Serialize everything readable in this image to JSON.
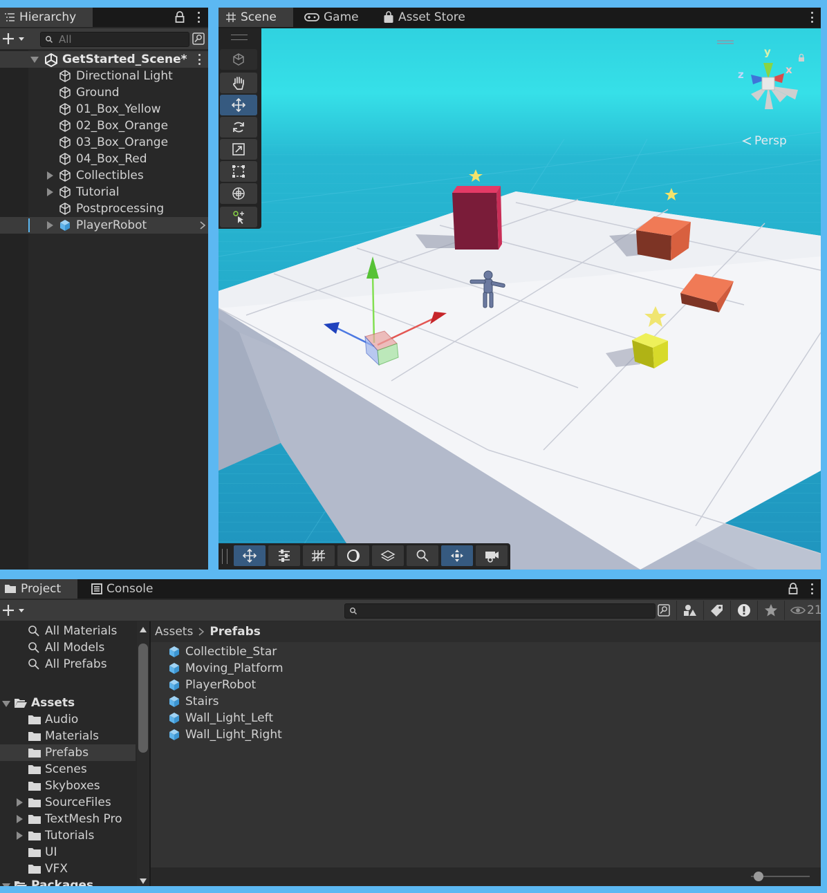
{
  "hierarchy": {
    "tab_label": "Hierarchy",
    "search_placeholder": "All",
    "scene_name": "GetStarted_Scene*",
    "items": [
      {
        "label": "Directional Light",
        "expandable": false
      },
      {
        "label": "Ground",
        "expandable": false
      },
      {
        "label": "01_Box_Yellow",
        "expandable": false
      },
      {
        "label": "02_Box_Orange",
        "expandable": false
      },
      {
        "label": "03_Box_Orange",
        "expandable": false
      },
      {
        "label": "04_Box_Red",
        "expandable": false
      },
      {
        "label": "Collectibles",
        "expandable": true
      },
      {
        "label": "Tutorial",
        "expandable": true
      },
      {
        "label": "Postprocessing",
        "expandable": false
      },
      {
        "label": "PlayerRobot",
        "expandable": true,
        "selected": true,
        "prefab": true
      }
    ]
  },
  "scene_view": {
    "tabs": [
      {
        "label": "Scene",
        "icon": "grid-icon",
        "active": true
      },
      {
        "label": "Game",
        "icon": "gamepad-icon",
        "active": false
      },
      {
        "label": "Asset Store",
        "icon": "bag-icon",
        "active": false
      }
    ],
    "projection_label": "Persp",
    "gizmo_axes": {
      "x": "x",
      "y": "y",
      "z": "z"
    },
    "tools": [
      "view-cube-icon",
      "hand-icon",
      "move-icon",
      "rotate-icon",
      "scale-icon",
      "rect-icon",
      "transform-icon",
      "custom-tool-icon"
    ],
    "selected_tool": "move-icon",
    "overlay_buttons": [
      "move-icon",
      "sliders-icon",
      "grid-snap-icon",
      "shading-icon",
      "layers-icon",
      "search-icon",
      "gizmo-icon",
      "camera-icon"
    ],
    "overlay_selected": [
      "move-icon",
      "gizmo-icon"
    ]
  },
  "project": {
    "tabs": [
      {
        "label": "Project",
        "icon": "folder-icon",
        "active": true
      },
      {
        "label": "Console",
        "icon": "console-icon",
        "active": false
      }
    ],
    "hidden_count": "21",
    "favorites": [
      "All Materials",
      "All Models",
      "All Prefabs"
    ],
    "assets_root": "Assets",
    "folders": [
      {
        "label": "Audio",
        "expandable": false
      },
      {
        "label": "Materials",
        "expandable": false
      },
      {
        "label": "Prefabs",
        "expandable": false,
        "selected": true
      },
      {
        "label": "Scenes",
        "expandable": false
      },
      {
        "label": "Skyboxes",
        "expandable": false
      },
      {
        "label": "SourceFiles",
        "expandable": true
      },
      {
        "label": "TextMesh Pro",
        "expandable": true
      },
      {
        "label": "Tutorials",
        "expandable": true
      },
      {
        "label": "UI",
        "expandable": false
      },
      {
        "label": "VFX",
        "expandable": false
      }
    ],
    "packages_root": "Packages",
    "breadcrumb": [
      "Assets",
      "Prefabs"
    ],
    "prefab_files": [
      "Collectible_Star",
      "Moving_Platform",
      "PlayerRobot",
      "Stairs",
      "Wall_Light_Left",
      "Wall_Light_Right"
    ],
    "zoom_slider": 0.05
  },
  "colors": {
    "accent": "#5cb8f2",
    "selection": "#3e6a94",
    "panel_bg": "#282828",
    "prefab_blue": "#5fb3ea"
  }
}
